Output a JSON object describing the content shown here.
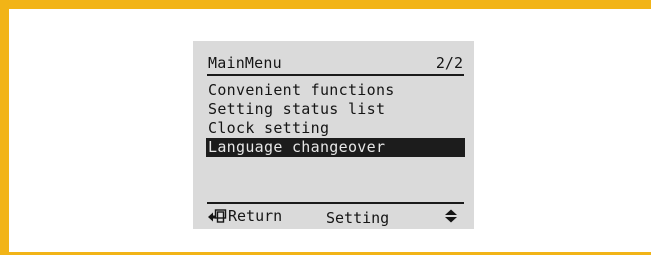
{
  "screen": {
    "title": "MainMenu",
    "page_indicator": "2/2"
  },
  "menu": {
    "items": [
      {
        "label": "Convenient functions",
        "selected": false
      },
      {
        "label": "Setting status list",
        "selected": false
      },
      {
        "label": "Clock setting",
        "selected": false
      },
      {
        "label": "Language changeover",
        "selected": true
      }
    ]
  },
  "footer": {
    "return_label": "Return",
    "setting_label": "Setting",
    "return_icon": "return-arrow-icon",
    "navigate_icon": "up-down-arrows-icon"
  },
  "colors": {
    "frame": "#f2b417",
    "lcd_background": "#dadada",
    "highlight": "#1c1c1c"
  }
}
